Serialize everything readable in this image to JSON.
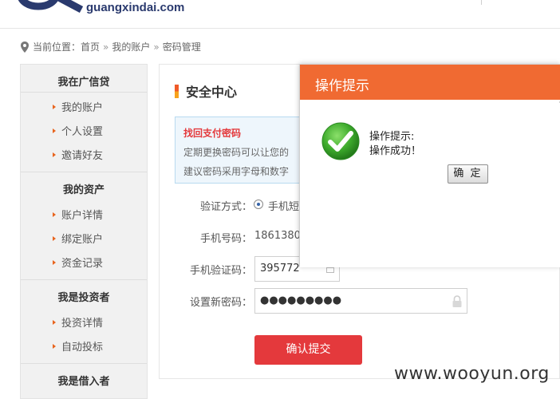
{
  "header": {
    "domain": "guangxindai.com"
  },
  "breadcrumb": {
    "prefix": "当前位置：",
    "home": "首页",
    "sep": "»",
    "account": "我的账户",
    "current": "密码管理"
  },
  "sidebar": {
    "groups": [
      {
        "title": "我在广信贷",
        "items": [
          "我的账户",
          "个人设置",
          "邀请好友"
        ]
      },
      {
        "title": "我的资产",
        "items": [
          "账户详情",
          "绑定账户",
          "资金记录"
        ]
      },
      {
        "title": "我是投资者",
        "items": [
          "投资详情",
          "自动投标"
        ]
      },
      {
        "title": "我是借入者",
        "items": []
      }
    ]
  },
  "main": {
    "section_title": "安全中心",
    "notice": {
      "title": "找回支付密码",
      "line1": "定期更换密码可以让您的",
      "line2": "建议密码采用字母和数字"
    },
    "form": {
      "verify_label": "验证方式：",
      "verify_value": "手机短",
      "phone_label": "手机号码：",
      "phone_value": "1861380",
      "code_label": "手机验证码：",
      "code_value": "395772",
      "newpwd_label": "设置新密码：",
      "newpwd_value": "●●●●●●●●●",
      "submit_label": "确认提交"
    }
  },
  "dialog": {
    "title": "操作提示",
    "message_line1": "操作提示:",
    "message_line2": "操作成功！",
    "ok_label": "确 定"
  },
  "watermark": "www.wooyun.org",
  "colors": {
    "accent_orange": "#f06a32",
    "submit_red": "#e4393c",
    "brand_navy": "#2a3a6e",
    "success_green": "#3daa2c"
  }
}
